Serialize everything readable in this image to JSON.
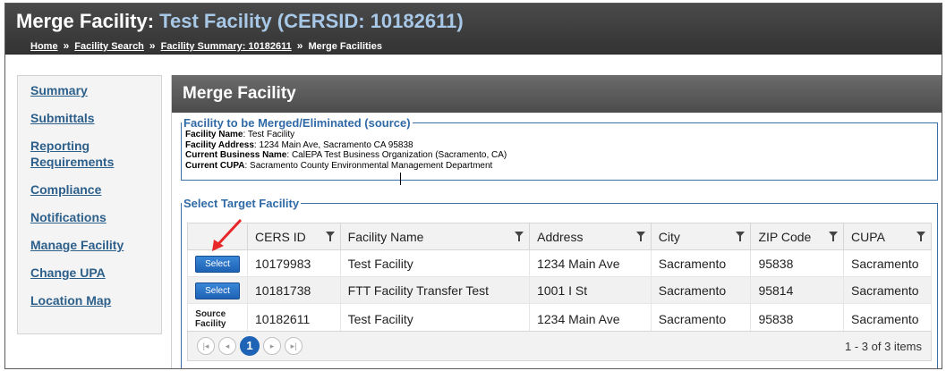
{
  "header": {
    "title_prefix": "Merge Facility:",
    "title_subject": "Test Facility (CERSID: 10182611)",
    "breadcrumb": [
      "Home",
      "Facility Search",
      "Facility Summary: 10182611",
      "Merge Facilities"
    ],
    "breadcrumb_sep": "»"
  },
  "sidebar": {
    "items": [
      "Summary",
      "Submittals",
      "Reporting Requirements",
      "Compliance",
      "Notifications",
      "Manage Facility",
      "Change UPA",
      "Location Map"
    ]
  },
  "panel": {
    "title": "Merge Facility"
  },
  "source": {
    "legend": "Facility to be Merged/Eliminated (source)",
    "fields": [
      {
        "label": "Facility Name",
        "value": "Test Facility"
      },
      {
        "label": "Facility Address",
        "value": "1234 Main Ave, Sacramento CA  95838"
      },
      {
        "label": "Current Business Name",
        "value": "CalEPA Test Business Organization (Sacramento, CA)"
      },
      {
        "label": "Current CUPA",
        "value": "Sacramento County Environmental Management Department"
      }
    ]
  },
  "target": {
    "legend": "Select Target Facility",
    "columns": [
      "CERS ID",
      "Facility Name",
      "Address",
      "City",
      "ZIP Code",
      "CUPA"
    ],
    "select_label": "Select",
    "source_label_line1": "Source",
    "source_label_line2": "Facility",
    "rows": [
      {
        "action": "Select",
        "cells": [
          "10179983",
          "Test Facility",
          "1234 Main Ave",
          "Sacramento",
          "95838",
          "Sacramento"
        ]
      },
      {
        "action": "Select",
        "cells": [
          "10181738",
          "FTT Facility Transfer Test",
          "1001 I St",
          "Sacramento",
          "95814",
          "Sacramento"
        ]
      },
      {
        "action": "Source",
        "cells": [
          "10182611",
          "Test Facility",
          "1234 Main Ave",
          "Sacramento",
          "95838",
          "Sacramento"
        ]
      }
    ]
  },
  "pager": {
    "current_page": "1",
    "first_icon": "first-page-icon",
    "prev_icon": "prev-page-icon",
    "next_icon": "next-page-icon",
    "last_icon": "last-page-icon",
    "info": "1 - 3 of 3 items"
  },
  "colors": {
    "link": "#2d5f8b",
    "legend": "#2f6aa6",
    "button": "#1e63b5",
    "arrow": "#e8272a"
  }
}
